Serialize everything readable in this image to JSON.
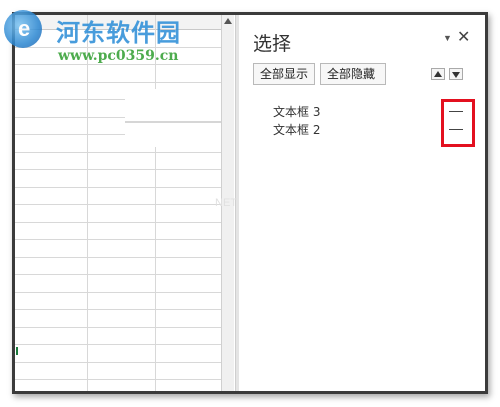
{
  "watermark": {
    "title": "河东软件园",
    "url": "www.pc0359.cn",
    "faint": "NET"
  },
  "selection_pane": {
    "title": "选择",
    "menu_icon": "dropdown-icon",
    "close_icon": "close-icon",
    "close_glyph": "✕",
    "menu_glyph": "▼",
    "buttons": {
      "show_all": "全部显示",
      "hide_all": "全部隐藏"
    },
    "order_buttons": [
      "bring-forward-icon",
      "send-backward-icon"
    ],
    "objects": [
      {
        "name": "文本框 3",
        "visibility_icon": "visibility-dash-icon"
      },
      {
        "name": "文本框 2",
        "visibility_icon": "visibility-dash-icon"
      }
    ]
  },
  "colors": {
    "highlight": "#e3101f",
    "watermark_blue": "#2f8fd8",
    "watermark_green": "#3aa33a"
  }
}
